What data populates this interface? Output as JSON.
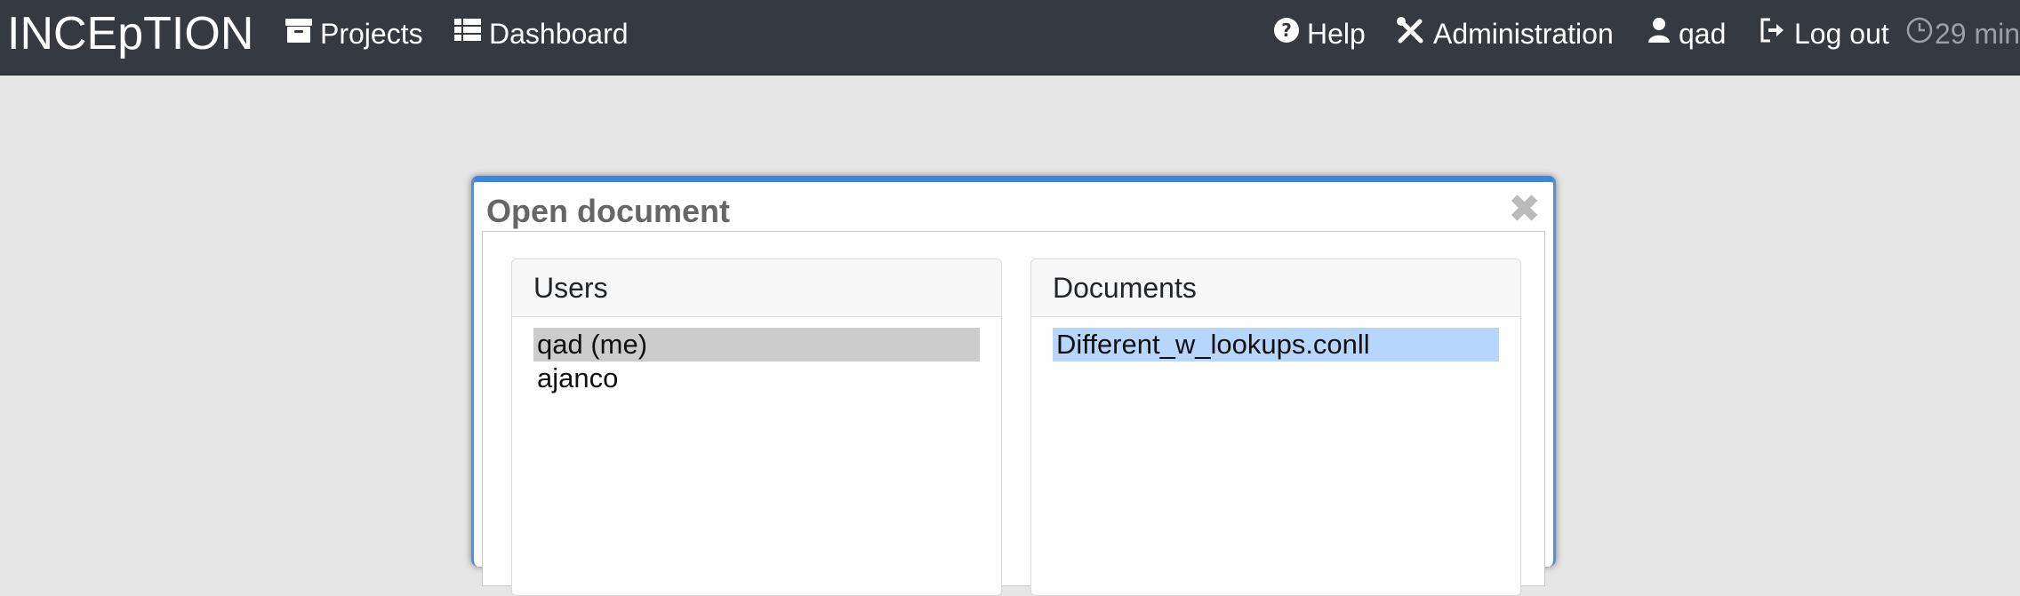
{
  "navbar": {
    "brand": "INCEpTION",
    "projects": "Projects",
    "dashboard": "Dashboard",
    "help": "Help",
    "administration": "Administration",
    "user": "qad",
    "logout": "Log out",
    "session_timer": "29 min"
  },
  "dialog": {
    "title": "Open document",
    "users_header": "Users",
    "users": [
      "qad (me)",
      "ajanco"
    ],
    "documents_header": "Documents",
    "documents": [
      "Different_w_lookups.conll"
    ]
  },
  "colors": {
    "navbar_bg": "#343a40",
    "page_bg": "#e6e6e6",
    "dialog_accent": "#3d86d8",
    "user_selection": "#cccccc",
    "document_selection": "#b6d6fc"
  }
}
